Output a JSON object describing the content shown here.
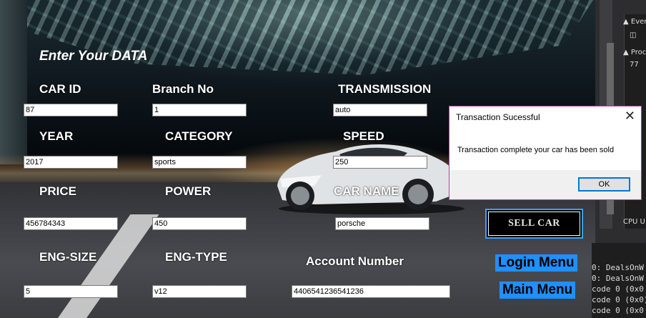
{
  "form": {
    "heading": "Enter Your DATA",
    "fields": {
      "car_id": {
        "label": "CAR ID",
        "value": "87"
      },
      "branch_no": {
        "label": "Branch No",
        "value": "1"
      },
      "transmission": {
        "label": "TRANSMISSION",
        "value": "auto"
      },
      "year": {
        "label": "YEAR",
        "value": "2017"
      },
      "category": {
        "label": "CATEGORY",
        "value": "sports"
      },
      "speed": {
        "label": "SPEED",
        "value": "250"
      },
      "price": {
        "label": "PRICE",
        "value": "456784343"
      },
      "power": {
        "label": "POWER",
        "value": "450"
      },
      "car_name": {
        "label": "CAR NAME",
        "value": "porsche"
      },
      "eng_size": {
        "label": "ENG-SIZE",
        "value": "5"
      },
      "eng_type": {
        "label": "ENG-TYPE",
        "value": "v12"
      },
      "account_number": {
        "label": "Account Number",
        "value": "4406541236541236"
      }
    },
    "sell_button": "SELL CAR",
    "login_menu": "Login Menu",
    "main_menu": "Main Menu"
  },
  "dialog": {
    "title": "Transaction Sucessful",
    "message": "Transaction complete your car has been sold",
    "ok_label": "OK"
  },
  "side_panel": {
    "events_label": "Even",
    "process_label": "Proc",
    "value": "77",
    "cpu_label": "CPU U"
  },
  "console": {
    "lines": [
      "0: DealsOnW",
      "0: DealsOnW",
      "code 0 (0x0",
      "code 0 (0x0)",
      "code 0 (0x0"
    ]
  },
  "colors": {
    "accent": "#1e90ff",
    "dialog_border": "#c33a8d"
  }
}
